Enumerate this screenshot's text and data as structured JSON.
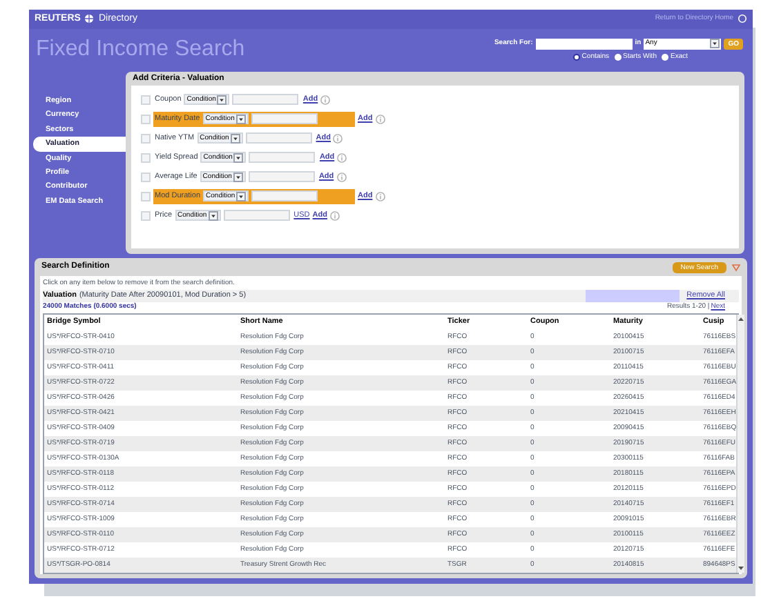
{
  "header": {
    "brand": "REUTERS",
    "product": "Directory",
    "home_link": "Return to Directory Home"
  },
  "title": "Fixed Income Search",
  "search": {
    "label": "Search For:",
    "in_label": "in",
    "scope": "Any",
    "go": "GO",
    "modes": [
      {
        "label": "Contains",
        "selected": true
      },
      {
        "label": "Starts With",
        "selected": false
      },
      {
        "label": "Exact",
        "selected": false
      }
    ]
  },
  "sidebar": {
    "items": [
      {
        "label": "Region",
        "selected": false
      },
      {
        "label": "Currency",
        "selected": false
      },
      {
        "label": "Sectors",
        "selected": false
      },
      {
        "label": "Valuation",
        "selected": true
      },
      {
        "label": "Quality",
        "selected": false
      },
      {
        "label": "Profile",
        "selected": false
      },
      {
        "label": "Contributor",
        "selected": false
      },
      {
        "label": "EM Data Search",
        "selected": false
      }
    ]
  },
  "criteria": {
    "title": "Add Criteria - Valuation",
    "rows": [
      {
        "label": "Coupon",
        "condition": "Condition",
        "checked": false,
        "highlighted": false,
        "add": "Add"
      },
      {
        "label": "Maturity Date",
        "condition": "Condition",
        "checked": false,
        "highlighted": true,
        "add": "Add"
      },
      {
        "label": "Native YTM",
        "condition": "Condition",
        "checked": false,
        "highlighted": false,
        "add": "Add"
      },
      {
        "label": "Yield Spread",
        "condition": "Condition",
        "checked": false,
        "highlighted": false,
        "add": "Add"
      },
      {
        "label": "Average Life",
        "condition": "Condition",
        "checked": false,
        "highlighted": false,
        "add": "Add"
      },
      {
        "label": "Mod Duration",
        "condition": "Condition",
        "checked": false,
        "highlighted": true,
        "add": "Add"
      },
      {
        "label": "Price",
        "condition": "Condition",
        "checked": false,
        "highlighted": false,
        "currency": "USD",
        "add": "Add"
      }
    ]
  },
  "definition": {
    "title": "Search Definition",
    "new_search": "New Search",
    "hint": "Click on any item below to remove it from the search definition.",
    "criteria_label": "Valuation",
    "criteria_text": "(Maturity Date After 20090101, Mod Duration > 5)",
    "remove_all": "Remove All",
    "matches": "24000 Matches (0.6000 secs)",
    "results": "Results 1-20 |",
    "next": "Next"
  },
  "table": {
    "columns": [
      "Bridge Symbol",
      "Short Name",
      "Ticker",
      "Coupon",
      "Maturity",
      "Cusip"
    ],
    "rows": [
      [
        "US*/RFCO-STR-0410",
        "Resolution Fdg Corp",
        "RFCO",
        "0",
        "20100415",
        "76116EBS"
      ],
      [
        "US*/RFCO-STR-0710",
        "Resolution Fdg Corp",
        "RFCO",
        "0",
        "20100715",
        "76116EFA"
      ],
      [
        "US*/RFCO-STR-0411",
        "Resolution Fdg Corp",
        "RFCO",
        "0",
        "20110415",
        "76116EBU"
      ],
      [
        "US*/RFCO-STR-0722",
        "Resolution Fdg Corp",
        "RFCO",
        "0",
        "20220715",
        "76116EGA"
      ],
      [
        "US*/RFCO-STR-0426",
        "Resolution Fdg Corp",
        "RFCO",
        "0",
        "20260415",
        "76116ED4"
      ],
      [
        "US*/RFCO-STR-0421",
        "Resolution Fdg Corp",
        "RFCO",
        "0",
        "20210415",
        "76116EEH"
      ],
      [
        "US*/RFCO-STR-0409",
        "Resolution Fdg Corp",
        "RFCO",
        "0",
        "20090415",
        "76116EBQ"
      ],
      [
        "US*/RFCO-STR-0719",
        "Resolution Fdg Corp",
        "RFCO",
        "0",
        "20190715",
        "76116EFU"
      ],
      [
        "US*/RFCO-STR-0130A",
        "Resolution Fdg Corp",
        "RFCO",
        "0",
        "20300115",
        "76116FAB"
      ],
      [
        "US*/RFCO-STR-0118",
        "Resolution Fdg Corp",
        "RFCO",
        "0",
        "20180115",
        "76116EPA"
      ],
      [
        "US*/RFCO-STR-0112",
        "Resolution Fdg Corp",
        "RFCO",
        "0",
        "20120115",
        "76116EPD"
      ],
      [
        "US*/RFCO-STR-0714",
        "Resolution Fdg Corp",
        "RFCO",
        "0",
        "20140715",
        "76116EF1"
      ],
      [
        "US*/RFCO-STR-1009",
        "Resolution Fdg Corp",
        "RFCO",
        "0",
        "20091015",
        "76116EBR"
      ],
      [
        "US*/RFCO-STR-0110",
        "Resolution Fdg Corp",
        "RFCO",
        "0",
        "20100115",
        "76116EEZ"
      ],
      [
        "US*/RFCO-STR-0712",
        "Resolution Fdg Corp",
        "RFCO",
        "0",
        "20120715",
        "76116EFE"
      ],
      [
        "US*/TSGR-PO-0814",
        "Treasury Strent Growth Rec",
        "TSGR",
        "0",
        "20140815",
        "894648PS"
      ]
    ]
  }
}
